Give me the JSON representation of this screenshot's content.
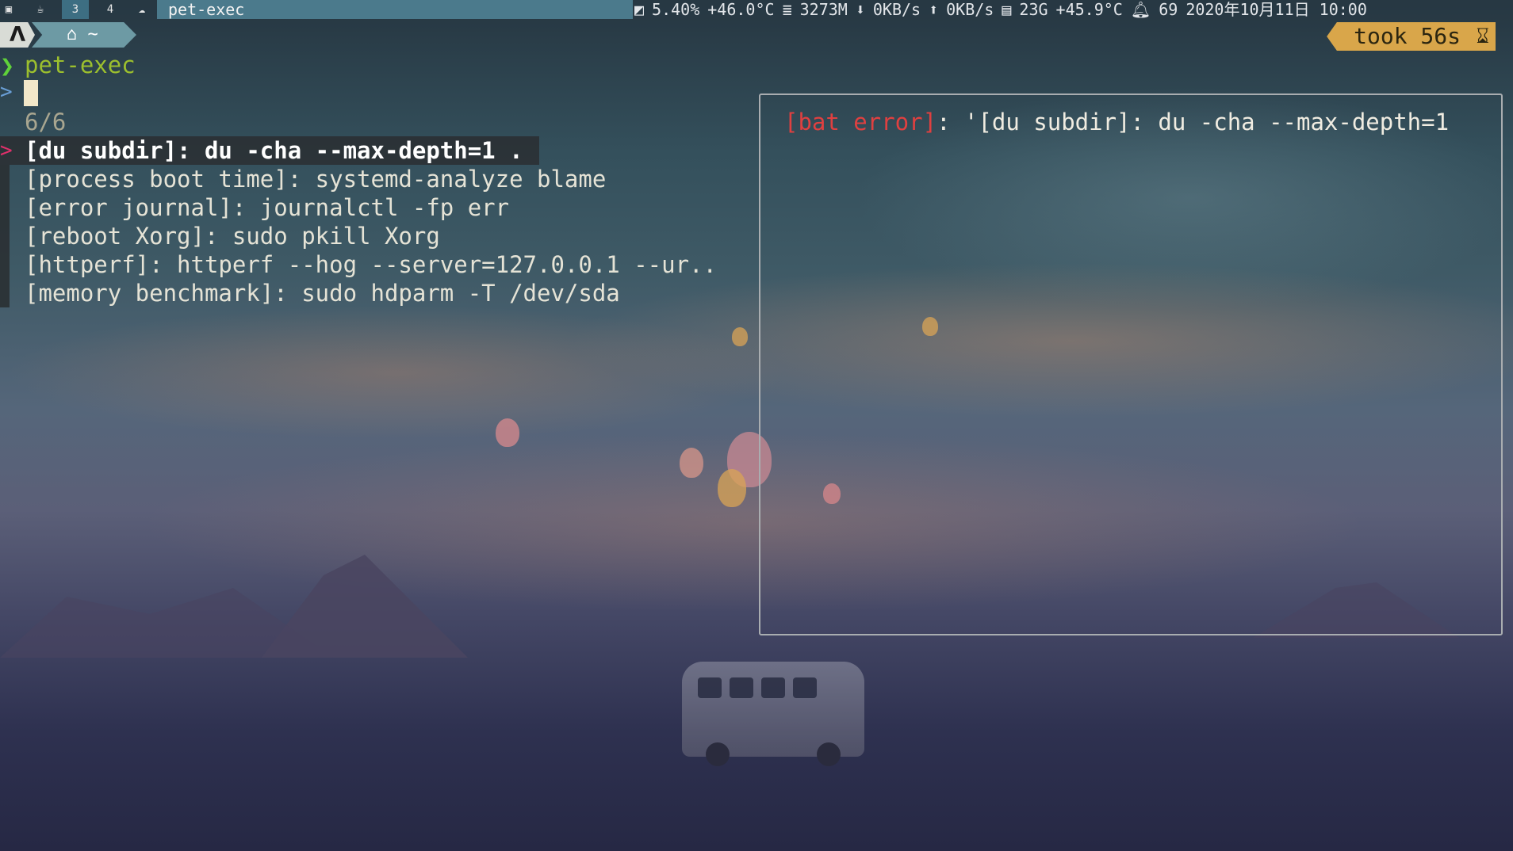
{
  "topbar": {
    "workspaces": [
      "3",
      "4"
    ],
    "window_title": "pet-exec",
    "cpu": "5.40%",
    "cpu_temp": "+46.0°C",
    "memory": "3273M",
    "net_down": "0KB/s",
    "net_up": "0KB/s",
    "disk": "23G",
    "disk_temp": "+45.9°C",
    "notifications": "69",
    "datetime": "2020年10月11日 10:00"
  },
  "prompt": {
    "home_symbol": "~",
    "took_label": "took 56s",
    "command": "pet-exec",
    "fzf_prompt": ">",
    "match_count": "6/6",
    "pointer": ">"
  },
  "results": [
    "[du subdir]: du -cha --max-depth=1 .",
    "[process boot time]: systemd-analyze blame",
    "[error journal]: journalctl -fp err",
    "[reboot Xorg]: sudo pkill Xorg",
    "[httperf]: httperf --hog --server=127.0.0.1 --ur..",
    "[memory benchmark]: sudo hdparm -T /dev/sda"
  ],
  "preview": {
    "error_tag": "[bat error]",
    "message": ": '[du subdir]: du -cha --max-depth=1"
  },
  "colors": {
    "accent_green": "#5fd13a",
    "command_color": "#9cbf2e",
    "pointer_color": "#e0306b",
    "error_red": "#e04040",
    "took_bg": "#d9a64a"
  }
}
